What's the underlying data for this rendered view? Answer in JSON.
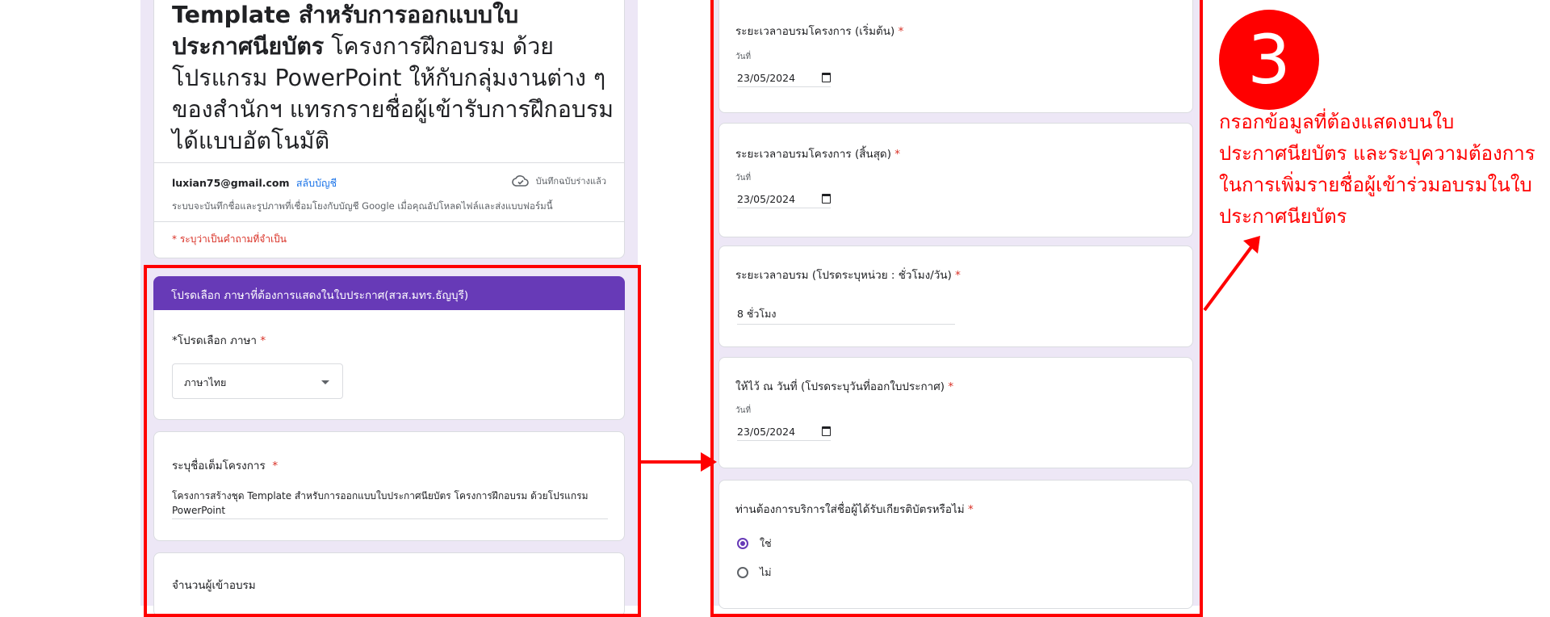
{
  "form": {
    "title_bold": "Template สำหรับการออกแบบใบประกาศนียบัตร",
    "title_rest": " โครงการฝึกอบรม ด้วยโปรแกรม PowerPoint ให้กับกลุ่มงานต่าง ๆ ของสำนักฯ แทรกรายชื่อผู้เข้ารับการฝึกอบรมได้แบบอัตโนมัติ",
    "account_email": "luxian75@gmail.com",
    "switch_account": "สลับบัญชี",
    "saved_status": "บันทึกฉบับร่างแล้ว",
    "record_note": "ระบบจะบันทึกชื่อและรูปภาพที่เชื่อมโยงกับบัญชี Google เมื่อคุณอัปโหลดไฟล์และส่งแบบฟอร์มนี้",
    "required_note": "* ระบุว่าเป็นคำถามที่จำเป็น"
  },
  "section": {
    "header": "โปรดเลือก ภาษาที่ต้องการแสดงในใบประกาศ(สวส.มทร.ธัญบุรี)",
    "language_label": "*โปรดเลือก ภาษา",
    "language_value": "ภาษาไทย",
    "project_label": "ระบุชื่อเต็มโครงการ",
    "project_value": "โครงการสร้างชุด Template สำหรับการออกแบบใบประกาศนียบัตร โครงการฝึกอบรม ด้วยโปรแกรม PowerPoint",
    "participants_label": "จำนวนผู้เข้าอบรม"
  },
  "right": {
    "start_label": "ระยะเวลาอบรมโครงการ (เริ่มต้น)",
    "end_label": "ระยะเวลาอบรมโครงการ (สิ้นสุด)",
    "date_small_label": "วันที่",
    "start_date": "23/05/2024",
    "end_date": "23/05/2024",
    "hours_label": "ระยะเวลาอบรม (โปรดระบุหน่วย : ชั่วโมง/วัน)",
    "hours_value": "8 ชั่วโมง",
    "issue_label": "ให้ไว้ ณ วันที่ (โปรดระบุวันที่ออกใบประกาศ)",
    "issue_date": "23/05/2024",
    "names_label": "ท่านต้องการบริการใส่ชื่อผู้ได้รับเกียรติบัตรหรือไม่",
    "option_yes": "ใช่",
    "option_no": "ไม่",
    "selected": "ใช่"
  },
  "annotation": {
    "step_number": "3",
    "text": "กรอกข้อมูลที่ต้องแสดงบนใบประกาศนียบัตร และระบุความต้องการในการเพิ่มรายชื่อผู้เข้าร่วมอบรมในใบประกาศนียบัตร",
    "color": "#ff0000"
  },
  "required_mark": "*",
  "colors": {
    "theme_purple": "#673ab7",
    "form_background": "#ede7f6",
    "required_red": "#d93025"
  }
}
